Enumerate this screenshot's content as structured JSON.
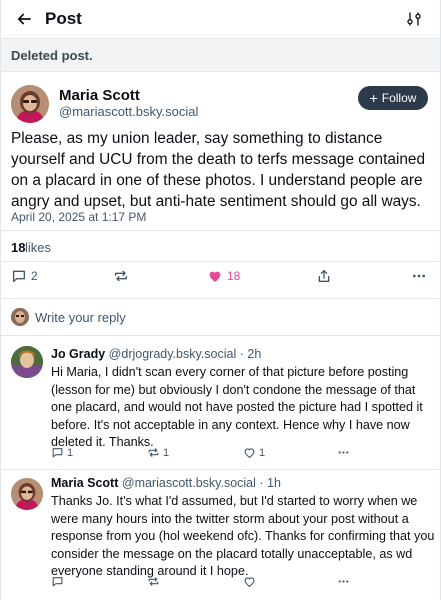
{
  "header": {
    "title": "Post",
    "back_icon": "arrow-left-icon",
    "settings_icon": "sliders-icon"
  },
  "banner": {
    "text": "Deleted post."
  },
  "post": {
    "author_name": "Maria Scott",
    "author_handle": "@mariascott.bsky.social",
    "follow_label": "Follow",
    "text": "Please, as my union leader, say something to distance yourself and UCU from the death to terfs message contained on a placard in one of these photos. I understand people are angry and upset, but anti-hate sentiment should go all ways.",
    "date": "April 20, 2025 at 1:17 PM",
    "likes_count": "18",
    "likes_label": "likes",
    "reply_count": "2",
    "repost_count": "",
    "like_count": "18"
  },
  "composer": {
    "prompt": "Write your reply"
  },
  "replies": [
    {
      "name": "Jo Grady",
      "handle": "@drjogrady.bsky.social",
      "sep": "·",
      "time": "2h",
      "text": "Hi Maria, I didn't scan every corner of that picture before posting (lesson for me) but obviously I don't condone the message of that one placard, and would not have posted the picture had I spotted it before. It's not acceptable in any context. Hence why I have now deleted it. Thanks.",
      "reply_count": "1",
      "repost_count": "1",
      "like_count": "1"
    },
    {
      "name": "Maria Scott",
      "handle": "@mariascott.bsky.social",
      "sep": "·",
      "time": "1h",
      "text": "Thanks Jo. It's what I'd assumed, but I'd started to worry when we were many hours into the twitter storm about your post without a response from you (hol weekend ofc). Thanks for confirming that you consider the message on the placard totally unacceptable, as wd everyone standing around it I hope.",
      "reply_count": "",
      "repost_count": "",
      "like_count": ""
    }
  ],
  "colors": {
    "like_active": "#ec4899",
    "follow_bg": "#2c3a4a",
    "muted": "#42576c",
    "banner_bg": "#f1f3f5"
  }
}
